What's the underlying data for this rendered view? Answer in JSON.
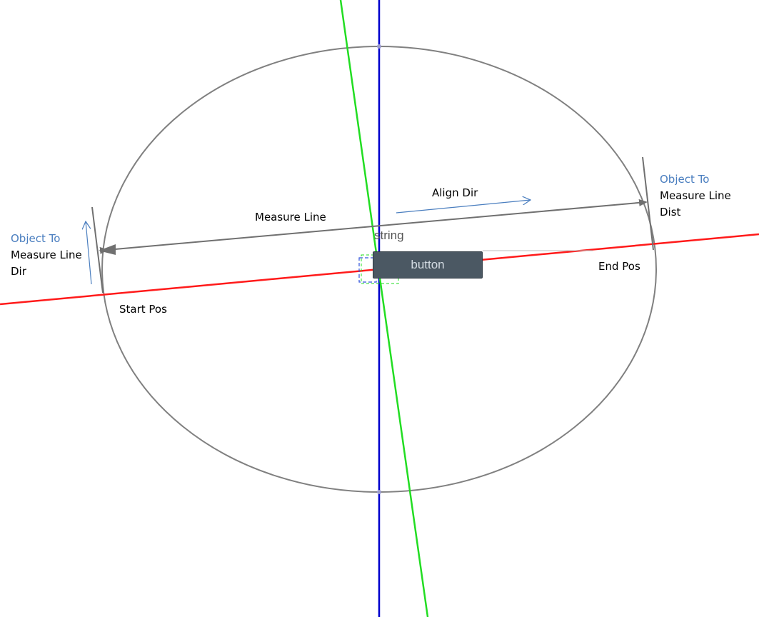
{
  "labels": {
    "measure_line": "Measure Line",
    "align_dir": "Align Dir",
    "start_pos": "Start Pos",
    "end_pos": "End Pos",
    "left_object_to": "Object To",
    "left_measure_line": "Measure Line",
    "left_dir": "Dir",
    "right_object_to": "Object To",
    "right_measure_line": "Measure Line",
    "right_dist": "Dist"
  },
  "widget": {
    "string_label": "string",
    "button_label": "button"
  },
  "colors": {
    "ellipse": "#808080",
    "measure_line": "#707070",
    "red_axis": "#ff1a1a",
    "green_axis": "#22dd22",
    "blue_axis": "#0000cc",
    "annotation_arrow": "#4a7ebf",
    "annotation_text": "#4a7ebf",
    "button_bg": "#4b5863"
  }
}
